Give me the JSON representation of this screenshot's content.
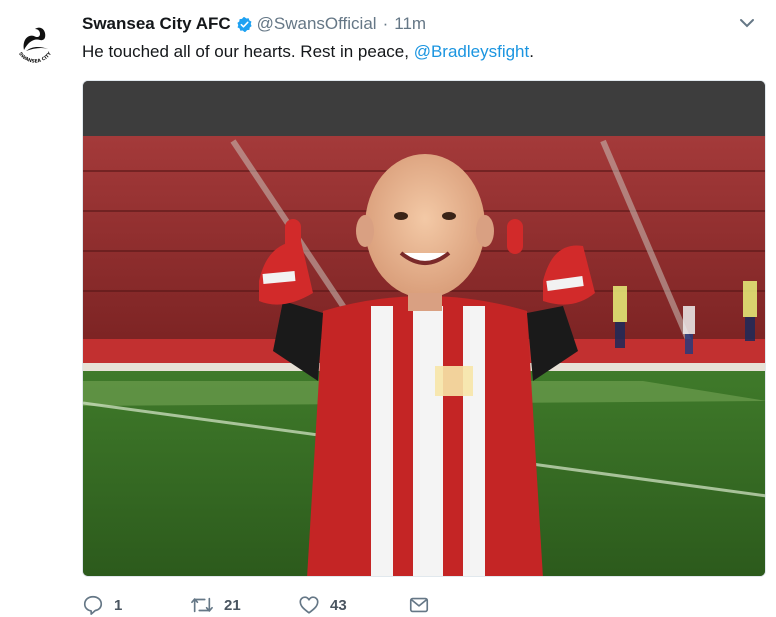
{
  "tweet": {
    "display_name": "Swansea City AFC",
    "handle": "@SwansOfficial",
    "separator": "·",
    "time": "11m",
    "text": "He touched all of our hearts. Rest in peace, ",
    "mention": "@Bradleysfight",
    "text_end": "."
  },
  "avatar": {
    "logo_text": "SWANSEA CITY AFC"
  },
  "actions": {
    "replies": "1",
    "retweets": "21",
    "likes": "43"
  },
  "colors": {
    "link": "#1b95e0",
    "verified": "#1da1f2",
    "muted": "#657786"
  },
  "icons": [
    "swans-crest-icon",
    "verified-badge-icon",
    "chevron-down-icon",
    "reply-icon",
    "retweet-icon",
    "heart-icon",
    "direct-message-icon"
  ]
}
